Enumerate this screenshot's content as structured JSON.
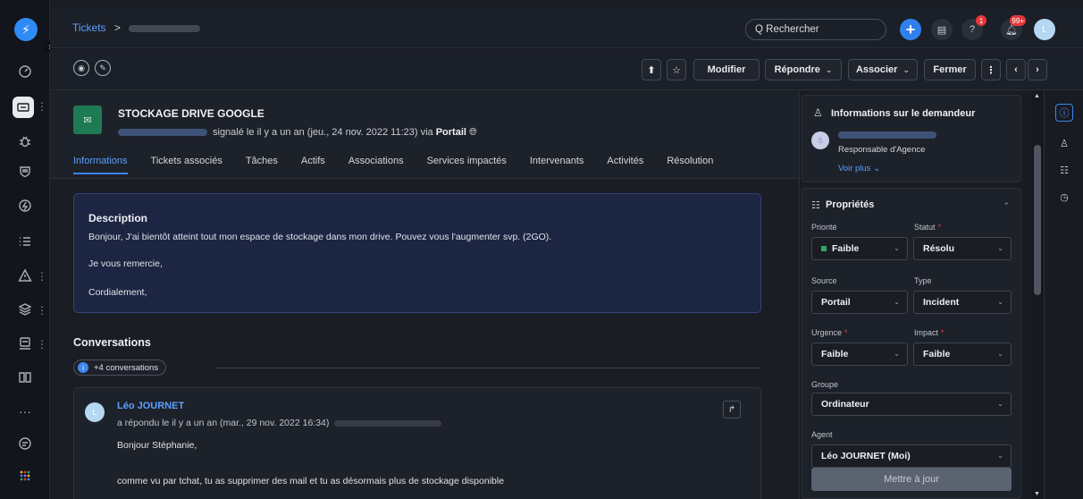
{
  "breadcrumb": {
    "root": "Tickets",
    "sep": ">"
  },
  "search": {
    "placeholder": "Q Rechercher"
  },
  "topbar": {
    "help_badge": "1",
    "notif_badge": "99+",
    "avatar": "L"
  },
  "actions": {
    "modifier": "Modifier",
    "repondre": "Répondre",
    "associer": "Associer",
    "fermer": "Fermer",
    "more": "⋮",
    "prev": "‹",
    "next": "›"
  },
  "ticket": {
    "title": "STOCKAGE DRIVE GOOGLE",
    "reported": "signalé le il y a un an (jeu., 24 nov. 2022 11:23) via",
    "via": "Portail",
    "tabs": [
      "Informations",
      "Tickets associés",
      "Tâches",
      "Actifs",
      "Associations",
      "Services impactés",
      "Intervenants",
      "Activités",
      "Résolution"
    ]
  },
  "description": {
    "title": "Description",
    "lines": [
      "Bonjour, J'ai bientôt atteint tout mon espace de stockage dans mon drive. Pouvez vous l'augmenter svp. (2GO).",
      "Je vous remercie,",
      "Cordialement,"
    ]
  },
  "conversations": {
    "title": "Conversations",
    "chip": "+4 conversations",
    "reply": {
      "avatar": "L",
      "author": "Léo JOURNET",
      "meta": "a répondu le il y a un an (mar., 29 nov. 2022 16:34)",
      "lines": [
        "Bonjour Stéphanie,",
        "comme vu par tchat, tu as supprimer des mail et tu as désormais plus de stockage disponible"
      ]
    }
  },
  "requester": {
    "title": "Informations sur le demandeur",
    "avatar": "S",
    "role": "Responsable d'Agence",
    "more": "Voir plus ⌄"
  },
  "properties": {
    "title": "Propriétés",
    "priority_label": "Priorité",
    "priority": "Faible",
    "status_label": "Statut",
    "status": "Résolu",
    "source_label": "Source",
    "source": "Portail",
    "type_label": "Type",
    "type": "Incident",
    "urgency_label": "Urgence",
    "urgency": "Faible",
    "impact_label": "Impact",
    "impact": "Faible",
    "group_label": "Groupe",
    "group": "Ordinateur",
    "agent_label": "Agent",
    "agent": "Léo JOURNET (Moi)",
    "update": "Mettre à jour"
  },
  "colors": {
    "accent": "#3f86f0",
    "ticket_icon": "#1e7a52",
    "badge": "#e5383b"
  }
}
